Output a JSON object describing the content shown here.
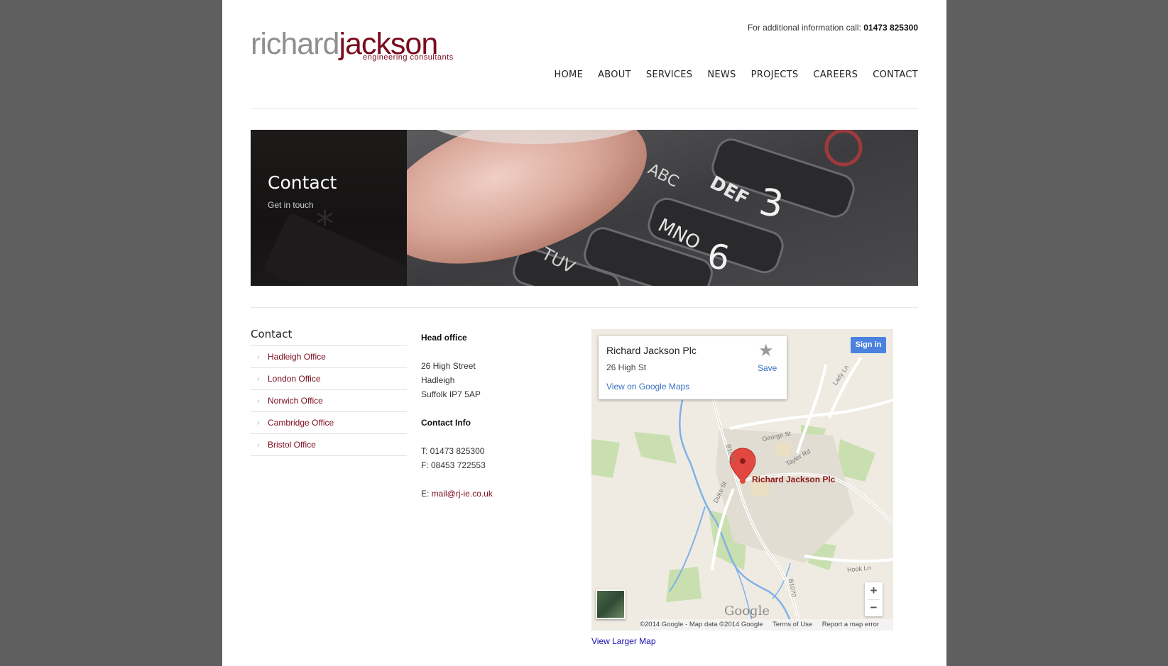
{
  "header": {
    "logo_part1": "richard",
    "logo_part2": "jackson",
    "logo_tagline": "engineering consultants",
    "call_prefix": "For additional information call:",
    "call_number": "01473 825300"
  },
  "nav": {
    "items": [
      "HOME",
      "ABOUT",
      "SERVICES",
      "NEWS",
      "PROJECTS",
      "CAREERS",
      "CONTACT"
    ]
  },
  "banner": {
    "title": "Contact",
    "subtitle": "Get in touch",
    "keys": [
      "ABC",
      "DEF",
      "3",
      "MNO",
      "6",
      "TUV"
    ]
  },
  "sidebar": {
    "heading": "Contact",
    "items": [
      "Hadleigh Office",
      "London Office",
      "Norwich Office",
      "Cambridge Office",
      "Bristol Office"
    ]
  },
  "address": {
    "head_title": "Head office",
    "line1": "26 High Street",
    "line2": "Hadleigh",
    "line3": "Suffolk IP7 5AP",
    "contact_title": "Contact Info",
    "tel": "T: 01473 825300",
    "fax": "F: 08453 722553",
    "email_prefix": "E: ",
    "email": "mail@rj-ie.co.uk"
  },
  "map": {
    "place_name": "Richard Jackson Plc",
    "place_address": "26 High St",
    "view_link": "View on Google Maps",
    "save_label": "Save",
    "signin_label": "Sign in",
    "pin_label": "Richard Jackson Plc",
    "google_mark": "Google",
    "attribution": "©2014 Google - Map data ©2014 Google",
    "terms": "Terms of Use",
    "report": "Report a map error",
    "zoom_in": "+",
    "zoom_out": "−",
    "streets": [
      "George St",
      "Tayler Rd",
      "B1070",
      "Duke St",
      "Hook Ln",
      "B1070",
      "Lady Ln"
    ],
    "larger_map": "View Larger Map"
  }
}
